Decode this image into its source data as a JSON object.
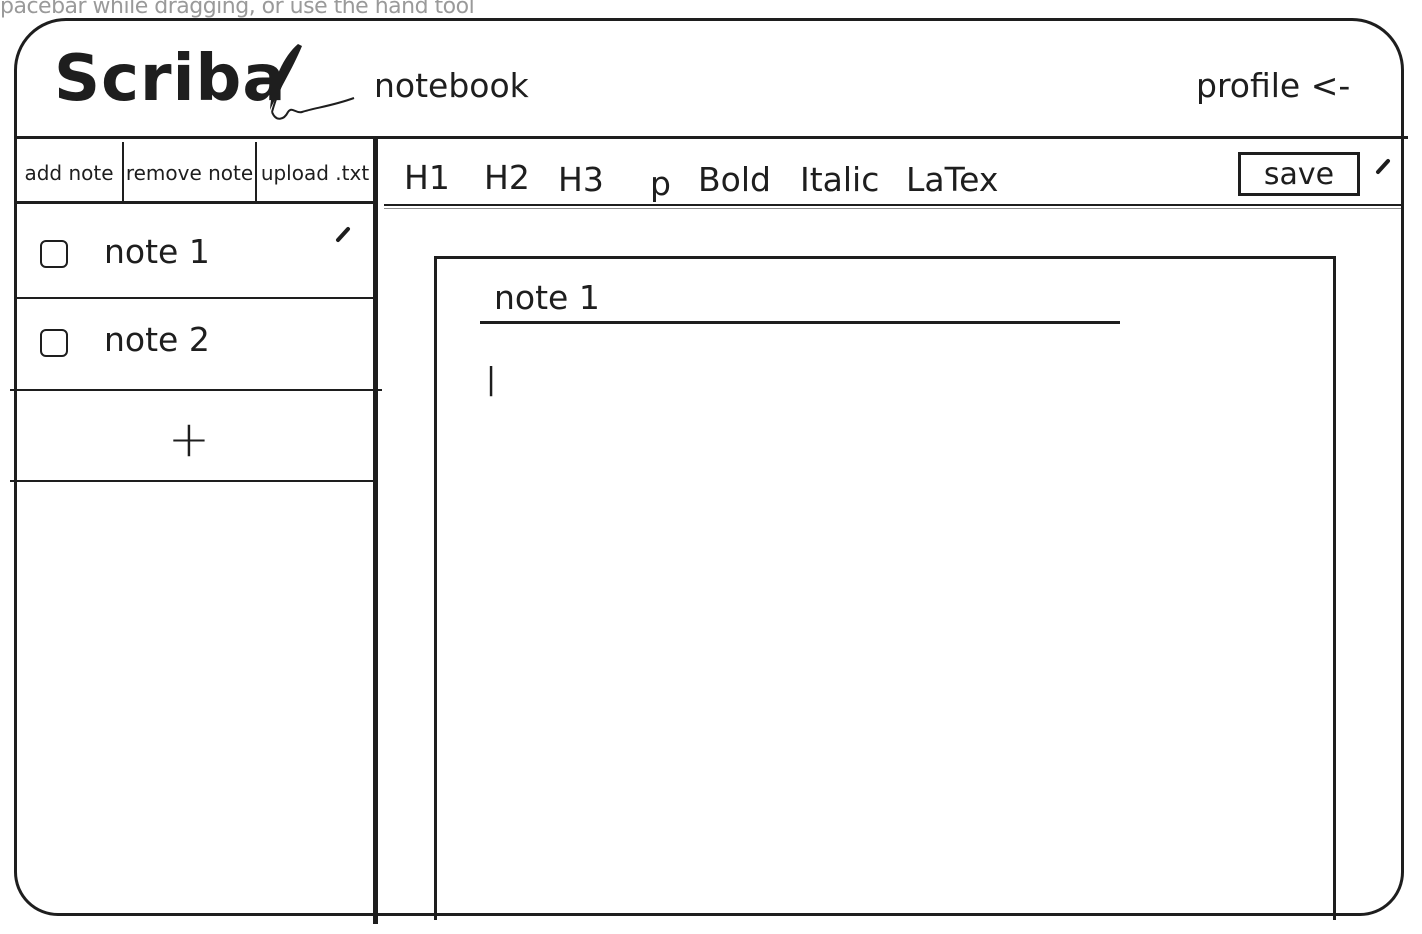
{
  "hint_text": "pacebar while dragging, or use the hand tool",
  "header": {
    "brand": "Scriba",
    "subtitle": "notebook",
    "profile_link": "profile <-"
  },
  "sidebar": {
    "toolbar": {
      "add_label": "add note",
      "remove_label": "remove note",
      "upload_label": "upload .txt"
    },
    "notes": [
      {
        "label": "note 1"
      },
      {
        "label": "note 2"
      }
    ],
    "add_symbol": "+"
  },
  "editor_toolbar": {
    "buttons": [
      "H1",
      "H2",
      "H3",
      "p",
      "Bold",
      "Italic",
      "LaTex"
    ],
    "save_label": "save"
  },
  "editor": {
    "title": "note 1",
    "body": "|"
  }
}
